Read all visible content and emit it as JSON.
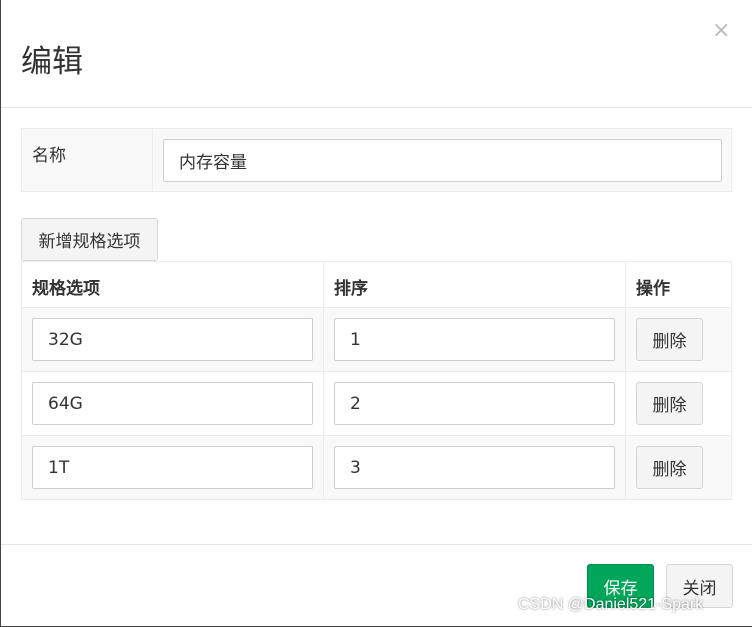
{
  "modal": {
    "title": "编辑",
    "close_symbol": "×"
  },
  "name_field": {
    "label": "名称",
    "value": "内存容量"
  },
  "add_button_label": "新增规格选项",
  "table": {
    "headers": [
      "规格选项",
      "排序",
      "操作"
    ],
    "rows": [
      {
        "option": "32G",
        "order": "1",
        "action": "删除"
      },
      {
        "option": "64G",
        "order": "2",
        "action": "删除"
      },
      {
        "option": "1T",
        "order": "3",
        "action": "删除"
      }
    ]
  },
  "footer": {
    "save_label": "保存",
    "close_label": "关闭"
  },
  "watermark": "CSDN @Daniel521-Spark",
  "colors": {
    "primary_green": "#00a65a",
    "panel_bg": "#f9f9f9",
    "border": "#cfcfcf"
  }
}
